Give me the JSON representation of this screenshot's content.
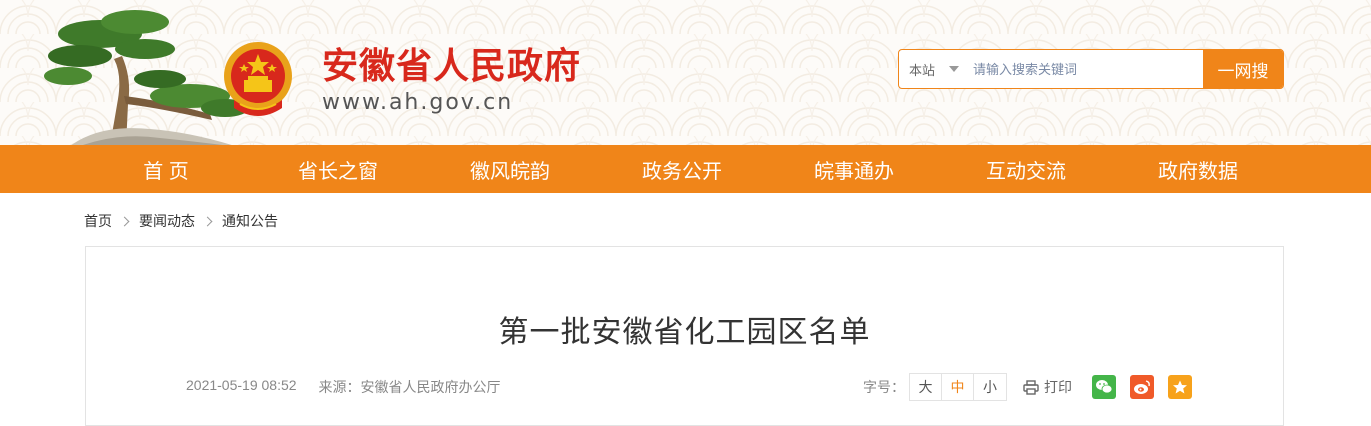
{
  "header": {
    "site_title": "安徽省人民政府",
    "site_domain": "www.ah.gov.cn",
    "search": {
      "scope_label": "本站",
      "placeholder": "请输入搜索关键词",
      "button_label": "一网搜"
    }
  },
  "nav": {
    "items": [
      {
        "label": "首 页"
      },
      {
        "label": "省长之窗"
      },
      {
        "label": "徽风皖韵"
      },
      {
        "label": "政务公开"
      },
      {
        "label": "皖事通办"
      },
      {
        "label": "互动交流"
      },
      {
        "label": "政府数据"
      }
    ]
  },
  "breadcrumb": {
    "items": [
      "首页",
      "要闻动态",
      "通知公告"
    ]
  },
  "article": {
    "title": "第一批安徽省化工园区名单",
    "date": "2021-05-19 08:52",
    "source_label": "来源：",
    "source_value": "安徽省人民政府办公厅",
    "font_size_label": "字号：",
    "font_sizes": [
      "大",
      "中",
      "小"
    ],
    "font_size_active": "中",
    "print_label": "打印"
  },
  "colors": {
    "accent": "#f08519",
    "title_red": "#d8281c",
    "wechat": "#44b549",
    "weibo": "#f05a29",
    "favorite": "#f7a21b"
  },
  "icons": {
    "logo": "national-emblem-icon",
    "banner": "welcoming-pine-icon",
    "print": "printer-icon",
    "share": [
      "wechat-icon",
      "weibo-icon",
      "star-icon"
    ]
  }
}
